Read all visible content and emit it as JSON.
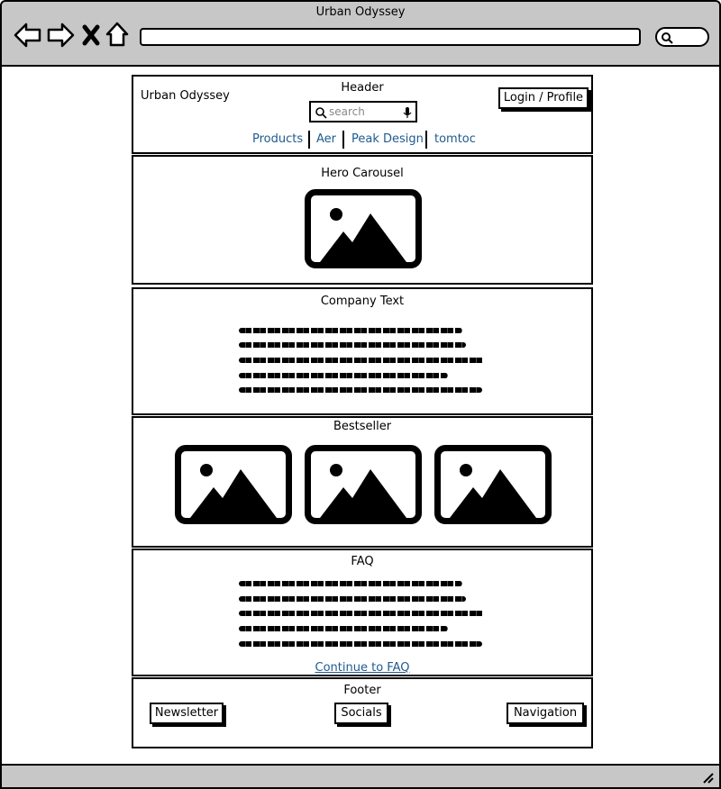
{
  "browser": {
    "title": "Urban Odyssey",
    "nav_icons": [
      "back-arrow-icon",
      "forward-arrow-icon",
      "close-icon",
      "home-icon"
    ],
    "search_icon": "search-icon",
    "resize_icon": "resize-grip-icon"
  },
  "header": {
    "section_label": "Header",
    "brand": "Urban Odyssey",
    "search_placeholder": "search",
    "login_label": "Login / Profile",
    "nav_links": [
      "Products",
      "Aer",
      "Peak Design",
      "tomtoc"
    ]
  },
  "hero": {
    "section_label": "Hero Carousel",
    "image_icon": "image-placeholder-icon"
  },
  "company": {
    "section_label": "Company Text"
  },
  "bestseller": {
    "section_label": "Bestseller",
    "image_count": 3
  },
  "faq": {
    "section_label": "FAQ",
    "link_label": "Continue to FAQ"
  },
  "footer": {
    "section_label": "Footer",
    "buttons": [
      "Newsletter",
      "Socials",
      "Navigation"
    ]
  }
}
